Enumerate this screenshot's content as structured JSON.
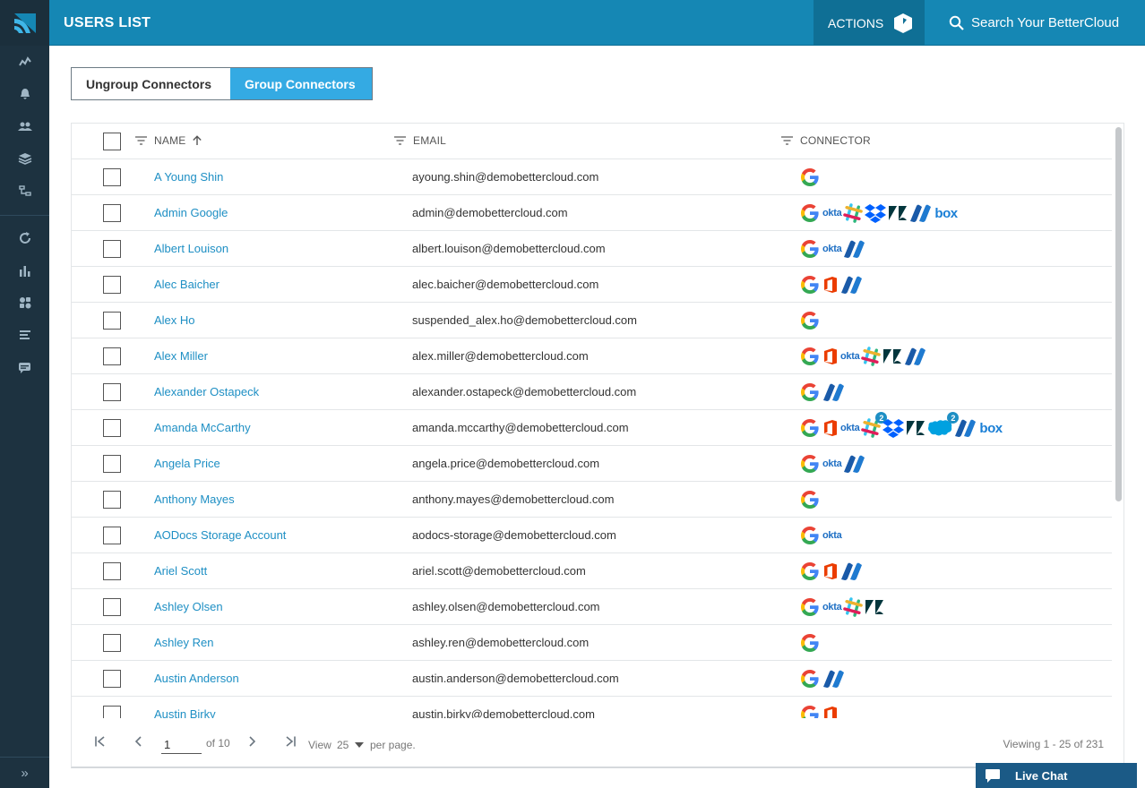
{
  "header": {
    "title": "USERS LIST",
    "actions_label": "ACTIONS",
    "search_label": "Search Your BetterCloud"
  },
  "toggle": {
    "ungroup_label": "Ungroup Connectors",
    "group_label": "Group Connectors",
    "selected": "Group Connectors"
  },
  "table": {
    "columns": {
      "name": "NAME",
      "email": "EMAIL",
      "connector": "CONNECTOR"
    },
    "sort": {
      "column": "NAME",
      "direction": "ascending"
    },
    "rows": [
      {
        "name": "A Young Shin",
        "email": "ayoung.shin@demobettercloud.com",
        "connectors": [
          "google"
        ]
      },
      {
        "name": "Admin Google",
        "email": "admin@demobettercloud.com",
        "connectors": [
          "google",
          "okta",
          "slack",
          "dropbox",
          "zendesk",
          "bettercloud",
          "box"
        ]
      },
      {
        "name": "Albert Louison",
        "email": "albert.louison@demobettercloud.com",
        "connectors": [
          "google",
          "okta",
          "bettercloud"
        ]
      },
      {
        "name": "Alec Baicher",
        "email": "alec.baicher@demobettercloud.com",
        "connectors": [
          "google",
          "office365",
          "bettercloud"
        ]
      },
      {
        "name": "Alex Ho",
        "email": "suspended_alex.ho@demobettercloud.com",
        "connectors": [
          "google"
        ]
      },
      {
        "name": "Alex Miller",
        "email": "alex.miller@demobettercloud.com",
        "connectors": [
          "google",
          "office365",
          "okta",
          "slack",
          "zendesk",
          "bettercloud"
        ]
      },
      {
        "name": "Alexander Ostapeck",
        "email": "alexander.ostapeck@demobettercloud.com",
        "connectors": [
          "google",
          "bettercloud"
        ]
      },
      {
        "name": "Amanda McCarthy",
        "email": "amanda.mccarthy@demobettercloud.com",
        "connectors": [
          "google",
          "office365",
          "okta",
          "slack:2",
          "dropbox",
          "zendesk",
          "salesforce:2",
          "bettercloud",
          "box"
        ]
      },
      {
        "name": "Angela Price",
        "email": "angela.price@demobettercloud.com",
        "connectors": [
          "google",
          "okta",
          "bettercloud"
        ]
      },
      {
        "name": "Anthony Mayes",
        "email": "anthony.mayes@demobettercloud.com",
        "connectors": [
          "google"
        ]
      },
      {
        "name": "AODocs Storage Account",
        "email": "aodocs-storage@demobettercloud.com",
        "connectors": [
          "google",
          "okta"
        ]
      },
      {
        "name": "Ariel Scott",
        "email": "ariel.scott@demobettercloud.com",
        "connectors": [
          "google",
          "office365",
          "bettercloud"
        ]
      },
      {
        "name": "Ashley Olsen",
        "email": "ashley.olsen@demobettercloud.com",
        "connectors": [
          "google",
          "okta",
          "slack",
          "zendesk"
        ]
      },
      {
        "name": "Ashley Ren",
        "email": "ashley.ren@demobettercloud.com",
        "connectors": [
          "google"
        ]
      },
      {
        "name": "Austin Anderson",
        "email": "austin.anderson@demobettercloud.com",
        "connectors": [
          "google",
          "bettercloud"
        ]
      },
      {
        "name": "Austin Birky",
        "email": "austin.birky@demobettercloud.com",
        "connectors": [
          "google",
          "office365"
        ]
      }
    ]
  },
  "pager": {
    "page": "1",
    "of_label": "of 10",
    "view_label": "View",
    "per_page_value": "25",
    "per_page_label": "per page.",
    "viewing_label": "Viewing 1 - 25 of 231"
  },
  "livechat": {
    "label": "Live Chat"
  },
  "icons": {
    "sidenav": [
      "dashboard-icon",
      "alerts-icon",
      "users-icon",
      "groups-icon",
      "directory-icon",
      "workflows-icon",
      "reports-icon",
      "integrations-icon",
      "logs-icon",
      "support-icon"
    ]
  },
  "colors": {
    "header": "#1587b4",
    "sidenav": "#1d3240",
    "accent": "#34aae3",
    "link": "#1e8fc4",
    "livechat": "#1b5a86"
  }
}
